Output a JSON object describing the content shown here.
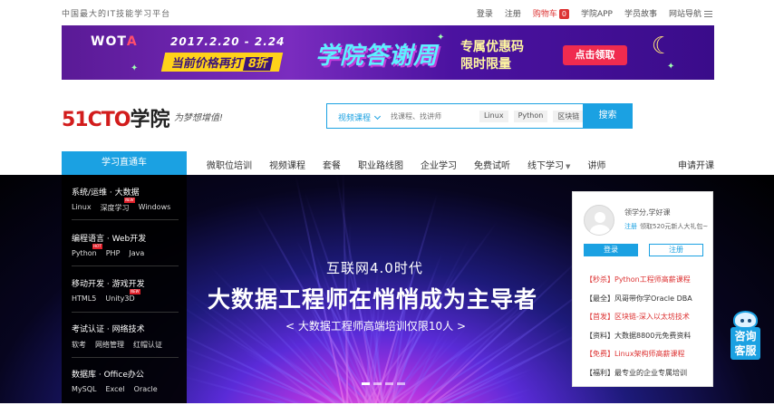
{
  "topbar": {
    "slogan": "中国最大的IT技能学习平台",
    "links": {
      "login": "登录",
      "register": "注册",
      "cart": "购物车",
      "cart_count": "0",
      "app": "学院APP",
      "stories": "学员故事",
      "sitemap": "网站导航"
    }
  },
  "banner": {
    "brand": "WOT",
    "brand_accent": "A",
    "dates": "2017.2.20 - 2.24",
    "price_text": "当前价格再打",
    "discount": "8折",
    "headline": "学院答谢周",
    "promo_line1": "专属优惠码",
    "promo_line2": "限时限量",
    "cta": "点击领取"
  },
  "header": {
    "logo_main": "51CTO",
    "logo_sub": "学院",
    "slogan": "为梦想增值!"
  },
  "search": {
    "category": "视频课程",
    "placeholder": "找课程、找讲师",
    "tags": [
      "Linux",
      "Python",
      "区块链"
    ],
    "button": "搜索"
  },
  "nav": {
    "direct": "学习直通车",
    "items": [
      "微职位培训",
      "视频课程",
      "套餐",
      "职业路线图",
      "企业学习",
      "免费试听",
      "线下学习",
      "讲师"
    ],
    "right": "申请开课"
  },
  "sidebar": [
    {
      "title": "系统/运维 · 大数据",
      "links": [
        "Linux",
        "深度学习",
        "Windows"
      ],
      "badges": [
        "",
        "NEW",
        ""
      ]
    },
    {
      "title": "编程语言 · Web开发",
      "links": [
        "Python",
        "PHP",
        "Java"
      ],
      "badges": [
        "HOT",
        "",
        ""
      ]
    },
    {
      "title": "移动开发 · 游戏开发",
      "links": [
        "HTML5",
        "Unity3D"
      ],
      "badges": [
        "",
        "NEW"
      ]
    },
    {
      "title": "考试认证 · 网络技术",
      "links": [
        "软考",
        "网络管理",
        "红帽认证"
      ],
      "badges": [
        "",
        "",
        ""
      ]
    },
    {
      "title": "数据库 · Office办公",
      "links": [
        "MySQL",
        "Excel",
        "Oracle"
      ],
      "badges": [
        "",
        "",
        ""
      ]
    }
  ],
  "hero": {
    "subtitle": "互联网4.0时代",
    "title": "大数据工程师在悄悄成为主导者",
    "desc": "< 大数据工程师高端培训仅限10人 >"
  },
  "login": {
    "welcome": "领学分,学好课",
    "reg_link": "注册",
    "reg_text": "领取520元新人大礼包~",
    "login_btn": "登录",
    "signup_btn": "注册",
    "list": [
      {
        "tag": "【秒杀】",
        "text": "Python工程师高薪课程",
        "plain": false
      },
      {
        "tag": "【最全】",
        "text": "风哥带你学Oracle DBA",
        "plain": true
      },
      {
        "tag": "【首发】",
        "text": "区块链-深入以太坊技术",
        "plain": false
      },
      {
        "tag": "【资料】",
        "text": "大数据8800元免费资料",
        "plain": true
      },
      {
        "tag": "【免费】",
        "text": "Linux架构师高薪课程",
        "plain": false
      },
      {
        "tag": "【福利】",
        "text": "最专业的企业专属培训",
        "plain": true
      }
    ]
  },
  "service": {
    "label": "咨询客服"
  },
  "colors": {
    "accent": "#1ba1e2",
    "brand_red": "#d21c1c",
    "promo_red": "#f02b4f"
  }
}
